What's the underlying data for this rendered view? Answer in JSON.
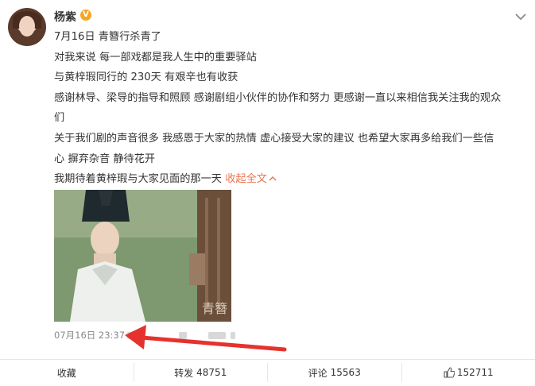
{
  "post": {
    "author": "杨紫",
    "verified_badge": "V",
    "lines": [
      "7月16日 青簪行杀青了",
      "对我来说 每一部戏都是我人生中的重要驿站",
      "与黄梓瑕同行的 230天 有艰辛也有收获",
      "感谢林导、梁导的指导和照顾 感谢剧组小伙伴的协作和努力 更感谢一直以来相信我关注我的观众",
      "们",
      "关于我们剧的声音很多 我感恩于大家的热情 虚心接受大家的建议 也希望大家再多给我们一些信",
      "心 摒弃杂音 静待花开"
    ],
    "last_line": "我期待着黄梓瑕与大家见面的那一天",
    "collapse_label": "收起全文",
    "image_caption": "青簪",
    "timestamp": "07月16日 23:37"
  },
  "actions": {
    "favorite": "收藏",
    "repost_label": "转发",
    "repost_count": "48751",
    "comment_label": "评论",
    "comment_count": "15563",
    "like_count": "152711"
  },
  "colors": {
    "accent_link": "#eb7350",
    "annotation_arrow": "#e5322d"
  },
  "icons": [
    "chevron-down-icon",
    "verified-badge-icon",
    "thumbs-up-icon",
    "chevron-up-icon"
  ]
}
